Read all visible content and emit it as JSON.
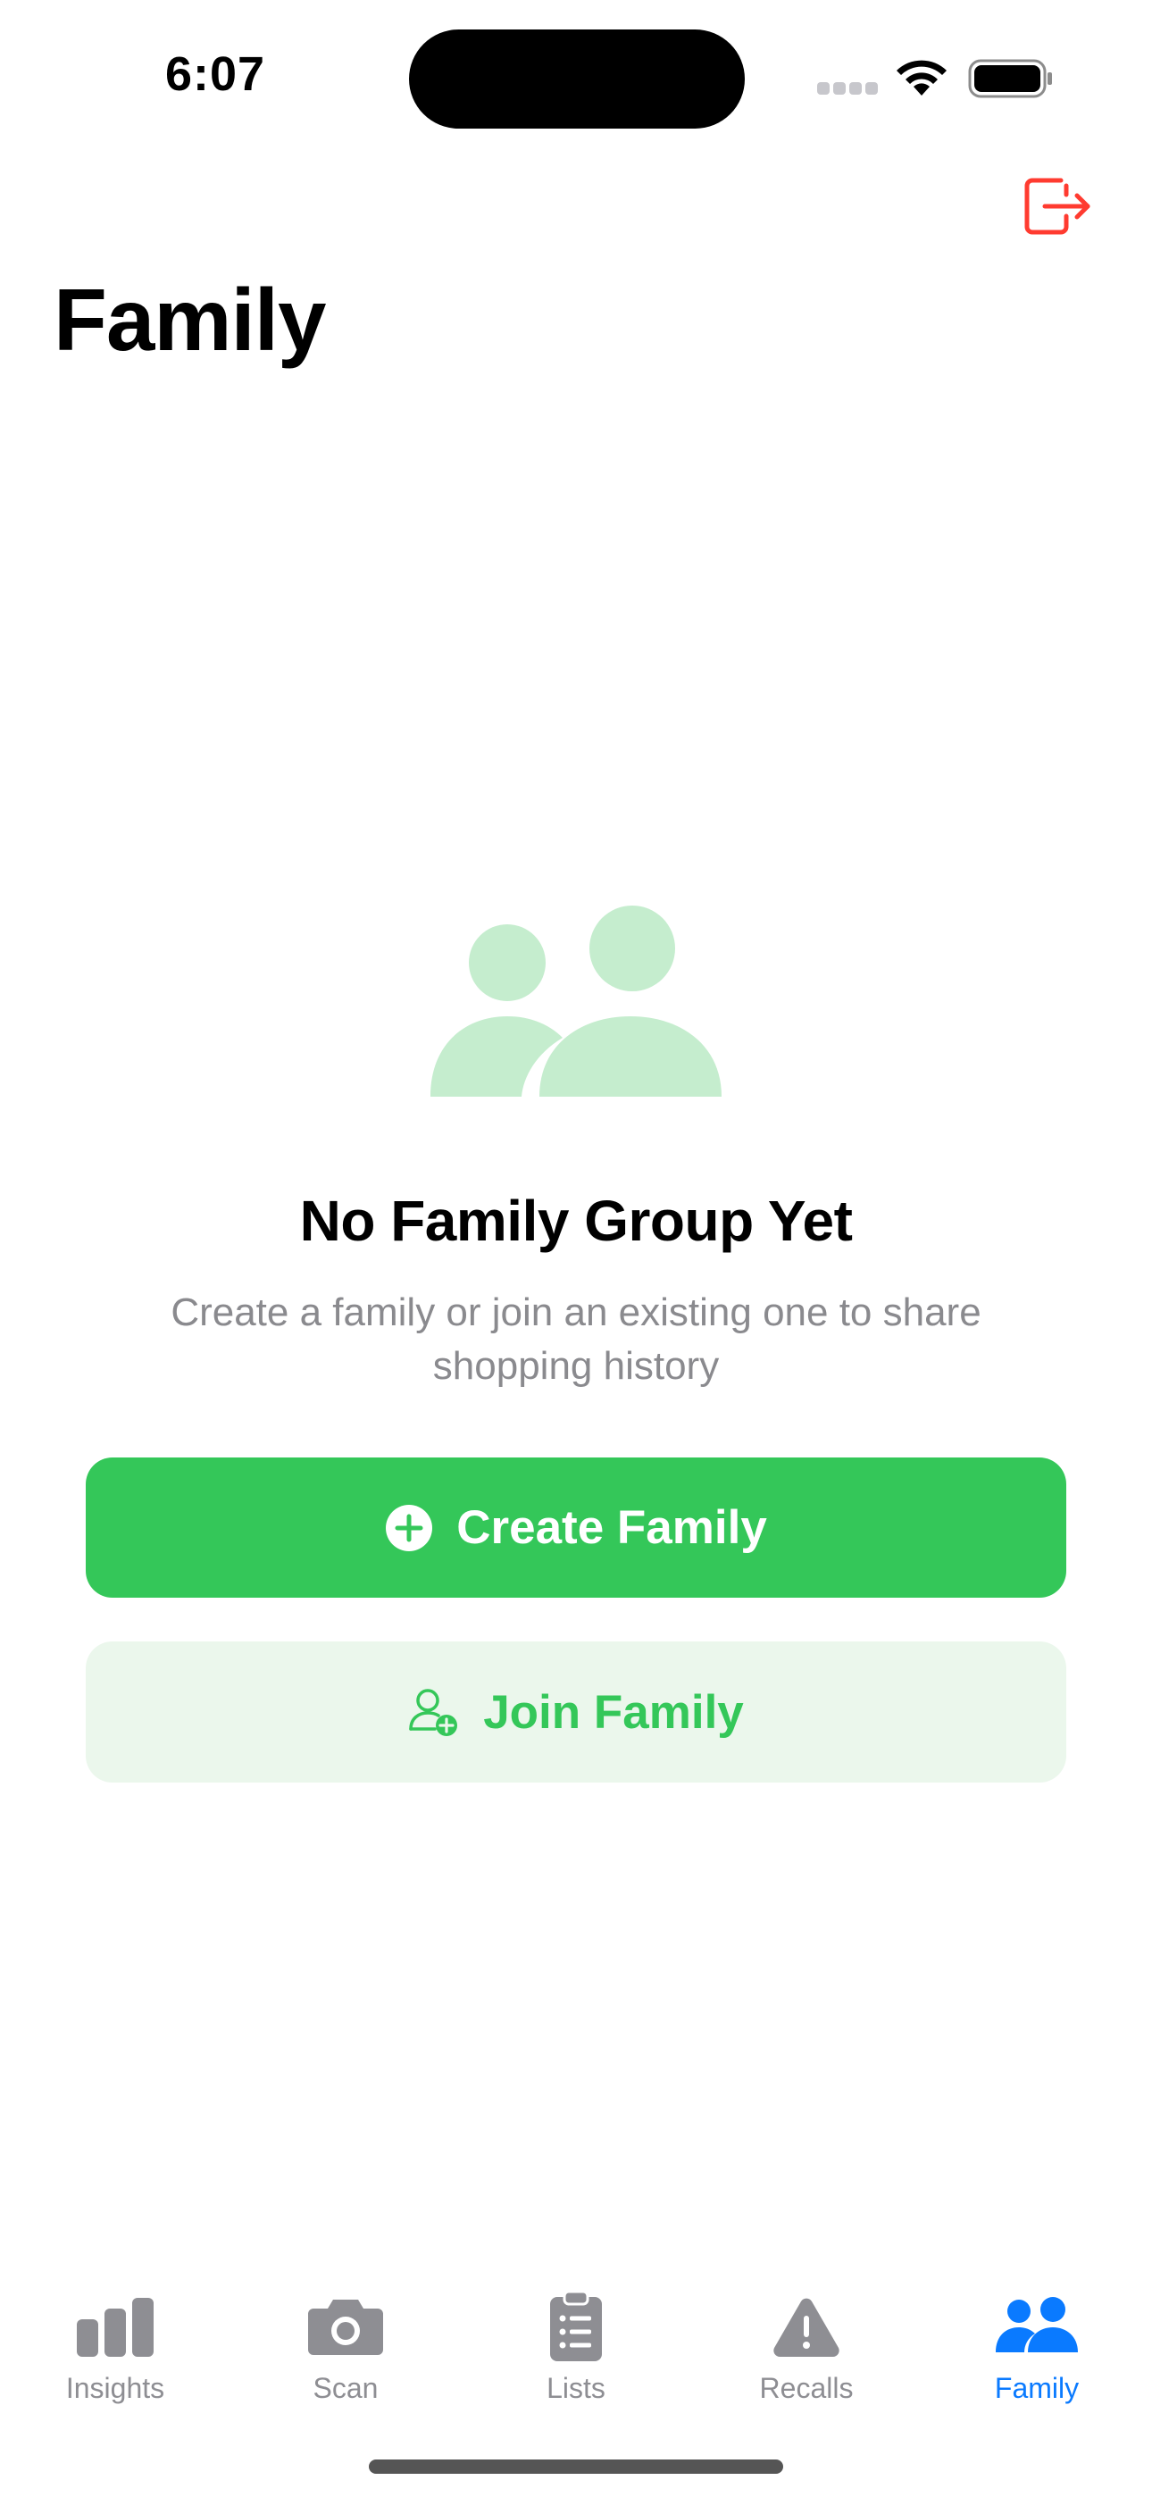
{
  "status_bar": {
    "time": "6:07"
  },
  "header": {
    "title": "Family",
    "logout_icon": "logout-icon"
  },
  "empty_state": {
    "icon": "people-icon",
    "title": "No Family Group Yet",
    "subtitle": "Create a family or join an existing one to share shopping history"
  },
  "actions": {
    "create_label": "Create Family",
    "join_label": "Join Family"
  },
  "tabs": [
    {
      "label": "Insights",
      "icon": "chart-bar-icon",
      "active": false
    },
    {
      "label": "Scan",
      "icon": "camera-icon",
      "active": false
    },
    {
      "label": "Lists",
      "icon": "clipboard-list-icon",
      "active": false
    },
    {
      "label": "Recalls",
      "icon": "warning-icon",
      "active": false
    },
    {
      "label": "Family",
      "icon": "people-icon",
      "active": true
    }
  ],
  "colors": {
    "accent_green": "#34c759",
    "join_bg": "#ebf7ec",
    "tab_active": "#0a7aff",
    "tab_inactive": "#8e8e93",
    "logout_red": "#ff3b30"
  }
}
